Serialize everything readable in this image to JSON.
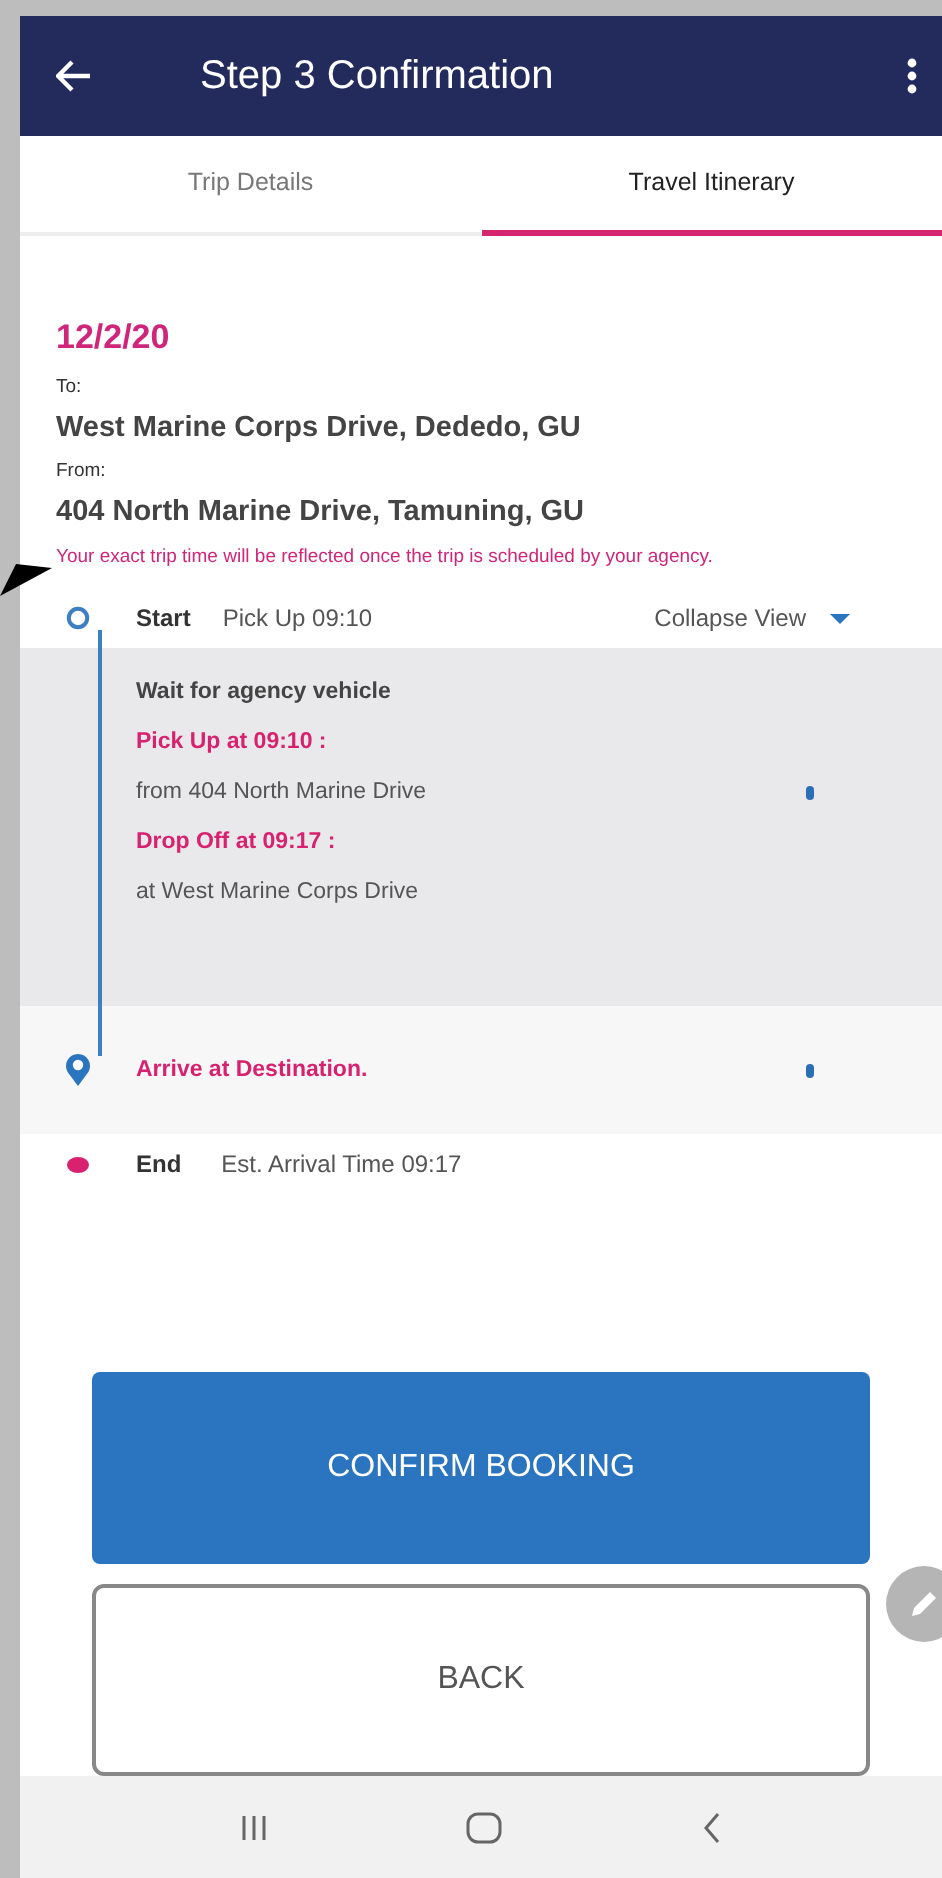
{
  "app_bar": {
    "title": "Step 3 Confirmation"
  },
  "tabs": [
    {
      "label": "Trip Details",
      "selected": false
    },
    {
      "label": "Travel Itinerary",
      "selected": true
    }
  ],
  "trip": {
    "date": "12/2/20",
    "to_label": "To:",
    "to": "West Marine Corps Drive, Dededo, GU",
    "from_label": "From:",
    "from": "404 North Marine Drive, Tamuning, GU",
    "notice": "Your exact trip time will be reflected once the trip is scheduled by your agency."
  },
  "timeline": {
    "start_label": "Start",
    "start_detail": "Pick Up 09:10",
    "toggle": "Collapse View",
    "expanded": true,
    "steps": [
      {
        "kind": "leg",
        "lines": [
          {
            "kind": "title",
            "text": "Wait for agency vehicle"
          },
          {
            "kind": "time",
            "text": "Pick Up at 09:10 :"
          },
          {
            "kind": "detail",
            "text": "from 404 North Marine Drive"
          },
          {
            "kind": "time",
            "text": "Drop Off at 09:17 :"
          },
          {
            "kind": "detail",
            "text": "at West Marine Corps Drive"
          }
        ]
      },
      {
        "kind": "arrival",
        "lines": [
          {
            "kind": "time",
            "text": "Arrive at Destination."
          }
        ]
      }
    ],
    "end_label": "End",
    "end_detail": "Est. Arrival Time 09:17"
  },
  "buttons": [
    {
      "kind": "primary",
      "label": "CONFIRM BOOKING"
    },
    {
      "kind": "outline",
      "label": "BACK"
    }
  ]
}
